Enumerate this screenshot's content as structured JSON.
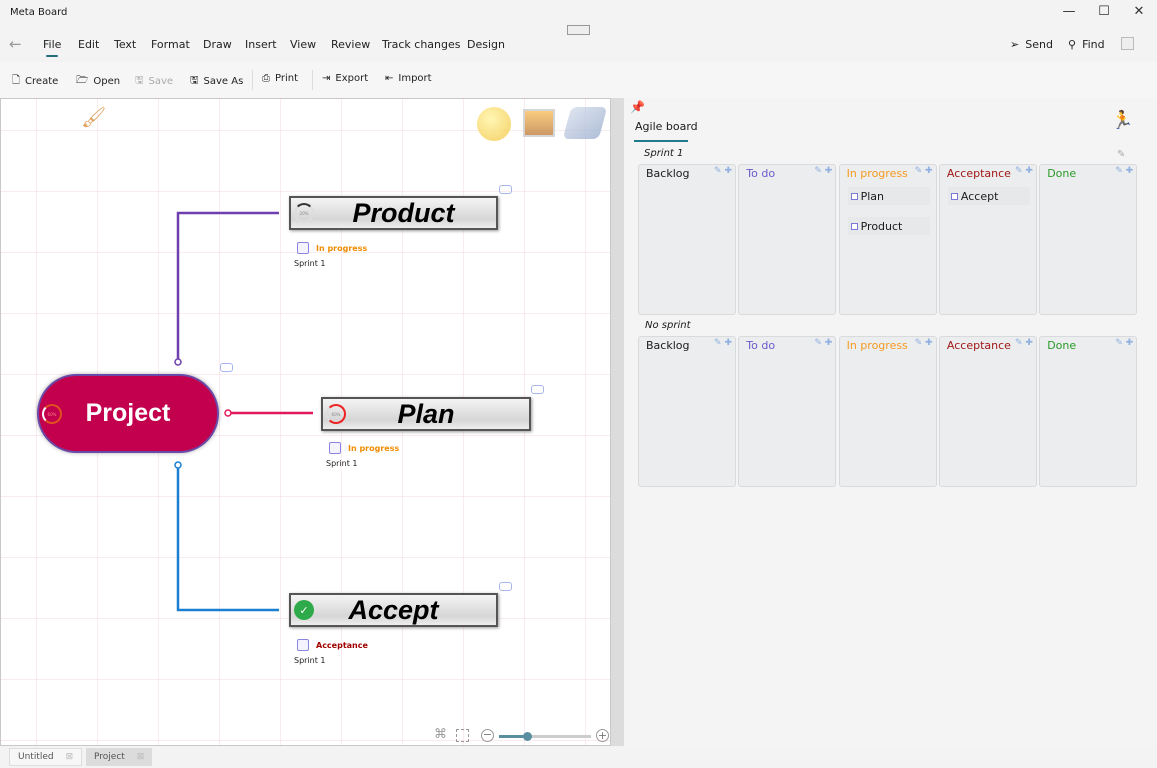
{
  "window": {
    "title": "Meta Board",
    "controls": [
      "minimize",
      "maximize",
      "close"
    ]
  },
  "menu": {
    "items": [
      "File",
      "Edit",
      "Text",
      "Format",
      "Draw",
      "Insert",
      "View",
      "Review",
      "Track changes",
      "Design"
    ],
    "active": "File",
    "send": "Send",
    "find": "Find"
  },
  "toolbar": {
    "create": "Create",
    "open": "Open",
    "save": "Save",
    "save_as": "Save As",
    "print": "Print",
    "export": "Export",
    "import": "Import"
  },
  "mindmap": {
    "root": {
      "title": "Project",
      "progress": "60%",
      "color": "#c2004e"
    },
    "nodes": [
      {
        "title": "Product",
        "progress": "20%",
        "status": "In progress",
        "status_color": "#f08c00",
        "sprint": "Sprint 1",
        "line_color": "#6f3fb0"
      },
      {
        "title": "Plan",
        "progress": "60%",
        "status": "In progress",
        "status_color": "#f08c00",
        "sprint": "Sprint 1",
        "line_color": "#e0195a"
      },
      {
        "title": "Accept",
        "progress": "100%",
        "status": "Acceptance",
        "status_color": "#a00000",
        "sprint": "Sprint 1",
        "line_color": "#1a7fd0"
      }
    ],
    "zoom_level": 0.3
  },
  "board": {
    "tab": "Agile board",
    "columns": [
      {
        "name": "Backlog",
        "color": "#1a1a1a"
      },
      {
        "name": "To do",
        "color": "#6a5acd"
      },
      {
        "name": "In progress",
        "color": "#f59a23"
      },
      {
        "name": "Acceptance",
        "color": "#a01818"
      },
      {
        "name": "Done",
        "color": "#2a9a2a"
      }
    ],
    "sections": [
      {
        "name": "Sprint 1",
        "cards": {
          "In progress": [
            "Plan",
            "Product"
          ],
          "Acceptance": [
            "Accept"
          ]
        }
      },
      {
        "name": "No sprint",
        "cards": {}
      }
    ]
  },
  "doc_tabs": [
    {
      "label": "Untitled",
      "active": false
    },
    {
      "label": "Project",
      "active": true
    }
  ]
}
